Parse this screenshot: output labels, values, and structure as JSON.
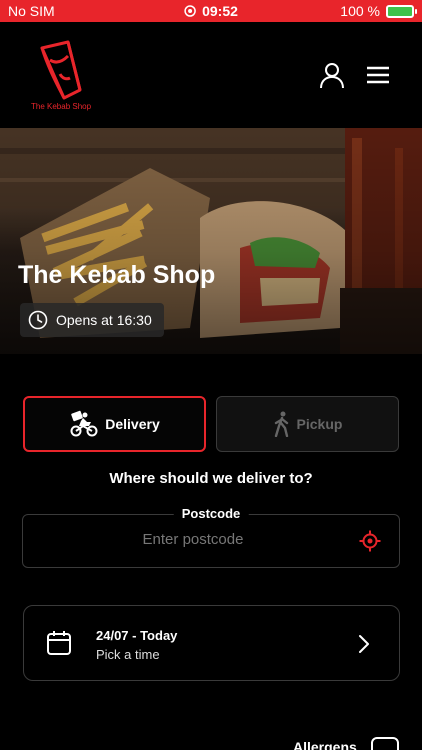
{
  "status_bar": {
    "carrier": "No SIM",
    "time": "09:52",
    "battery": "100 %"
  },
  "brand": {
    "logo_text": "The Kebab Shop",
    "accent_color": "#e8252b"
  },
  "header": {
    "icons": [
      "user-icon",
      "menu-icon"
    ]
  },
  "hero": {
    "title": "The Kebab Shop",
    "opens_label": "Opens at 16:30"
  },
  "order_mode": {
    "delivery_label": "Delivery",
    "pickup_label": "Pickup",
    "selected": "Delivery"
  },
  "delivery": {
    "question": "Where should we deliver to?",
    "postcode_label": "Postcode",
    "postcode_placeholder": "Enter postcode",
    "postcode_value": ""
  },
  "time_slot": {
    "date": "24/07 - Today",
    "pick_label": "Pick a time"
  },
  "footer": {
    "allergens_label": "Allergens"
  }
}
